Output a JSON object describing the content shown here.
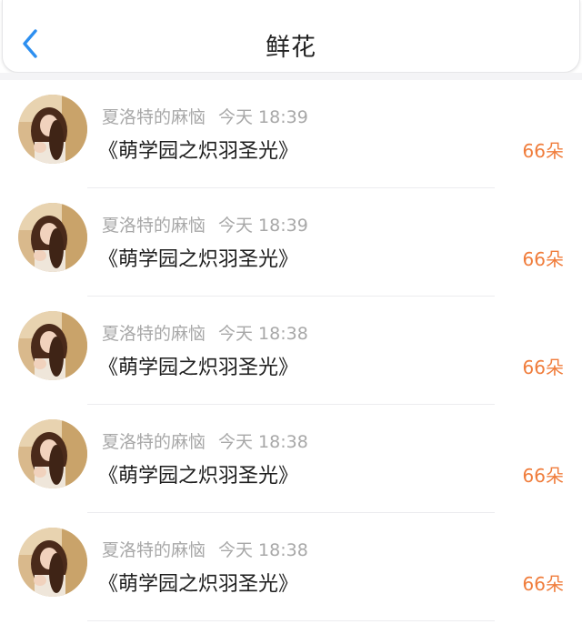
{
  "header": {
    "title": "鲜花",
    "back_icon": "chevron-left-icon",
    "accent": "#2d8ff0"
  },
  "records": [
    {
      "user": "夏洛特的麻恼",
      "time": "今天 18:39",
      "book": "《萌学园之炽羽圣光》",
      "amount": "66朵"
    },
    {
      "user": "夏洛特的麻恼",
      "time": "今天 18:39",
      "book": "《萌学园之炽羽圣光》",
      "amount": "66朵"
    },
    {
      "user": "夏洛特的麻恼",
      "time": "今天 18:38",
      "book": "《萌学园之炽羽圣光》",
      "amount": "66朵"
    },
    {
      "user": "夏洛特的麻恼",
      "time": "今天 18:38",
      "book": "《萌学园之炽羽圣光》",
      "amount": "66朵"
    },
    {
      "user": "夏洛特的麻恼",
      "time": "今天 18:38",
      "book": "《萌学园之炽羽圣光》",
      "amount": "66朵"
    }
  ],
  "colors": {
    "amount": "#f07d3c",
    "meta": "#a8a8a8",
    "text": "#1e1e1e"
  }
}
